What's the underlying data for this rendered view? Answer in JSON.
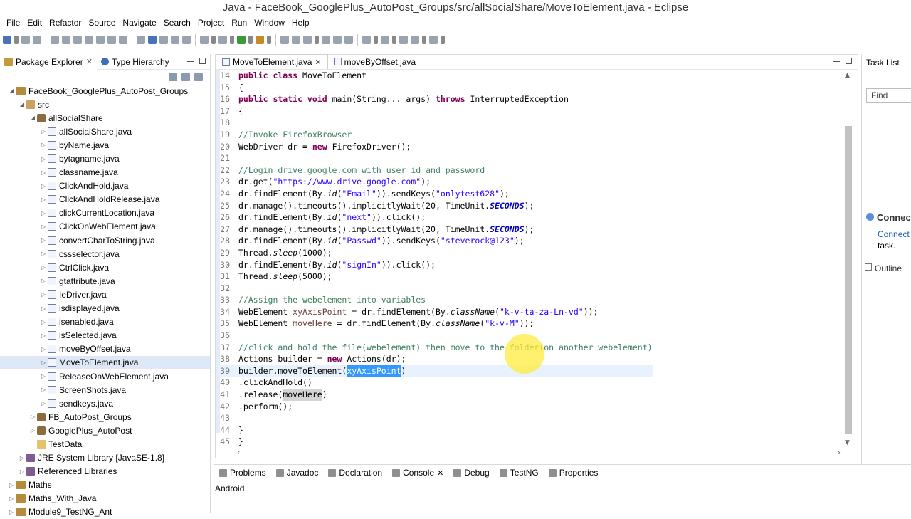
{
  "window": {
    "title": "Java - FaceBook_GooglePlus_AutoPost_Groups/src/allSocialShare/MoveToElement.java - Eclipse"
  },
  "menu": [
    "File",
    "Edit",
    "Refactor",
    "Source",
    "Navigate",
    "Search",
    "Project",
    "Run",
    "Window",
    "Help"
  ],
  "left_panel": {
    "tabs": [
      {
        "label": "Package Explorer",
        "active": true
      },
      {
        "label": "Type Hierarchy",
        "active": false
      }
    ],
    "tree": [
      {
        "label": "FaceBook_GooglePlus_AutoPost_Groups",
        "depth": 0,
        "arrow": "open",
        "icon": "proj"
      },
      {
        "label": "src",
        "depth": 1,
        "arrow": "open",
        "icon": "src"
      },
      {
        "label": "allSocialShare",
        "depth": 2,
        "arrow": "open",
        "icon": "pkg"
      },
      {
        "label": "allSocialShare.java",
        "depth": 3,
        "arrow": "closed",
        "icon": "java"
      },
      {
        "label": "byName.java",
        "depth": 3,
        "arrow": "closed",
        "icon": "java"
      },
      {
        "label": "bytagname.java",
        "depth": 3,
        "arrow": "closed",
        "icon": "java"
      },
      {
        "label": "classname.java",
        "depth": 3,
        "arrow": "closed",
        "icon": "java"
      },
      {
        "label": "ClickAndHold.java",
        "depth": 3,
        "arrow": "closed",
        "icon": "java"
      },
      {
        "label": "ClickAndHoldRelease.java",
        "depth": 3,
        "arrow": "closed",
        "icon": "java"
      },
      {
        "label": "clickCurrentLocation.java",
        "depth": 3,
        "arrow": "closed",
        "icon": "java"
      },
      {
        "label": "ClickOnWebElement.java",
        "depth": 3,
        "arrow": "closed",
        "icon": "java"
      },
      {
        "label": "convertCharToString.java",
        "depth": 3,
        "arrow": "closed",
        "icon": "java"
      },
      {
        "label": "cssselector.java",
        "depth": 3,
        "arrow": "closed",
        "icon": "java"
      },
      {
        "label": "CtrlClick.java",
        "depth": 3,
        "arrow": "closed",
        "icon": "java"
      },
      {
        "label": "gtattribute.java",
        "depth": 3,
        "arrow": "closed",
        "icon": "java"
      },
      {
        "label": "IeDriver.java",
        "depth": 3,
        "arrow": "closed",
        "icon": "java"
      },
      {
        "label": "isdisplayed.java",
        "depth": 3,
        "arrow": "closed",
        "icon": "java"
      },
      {
        "label": "isenabled.java",
        "depth": 3,
        "arrow": "closed",
        "icon": "java"
      },
      {
        "label": "isSelected.java",
        "depth": 3,
        "arrow": "closed",
        "icon": "java"
      },
      {
        "label": "moveByOffset.java",
        "depth": 3,
        "arrow": "closed",
        "icon": "java"
      },
      {
        "label": "MoveToElement.java",
        "depth": 3,
        "arrow": "closed",
        "icon": "java",
        "selected": true
      },
      {
        "label": "ReleaseOnWebElement.java",
        "depth": 3,
        "arrow": "closed",
        "icon": "java"
      },
      {
        "label": "ScreenShots.java",
        "depth": 3,
        "arrow": "closed",
        "icon": "java"
      },
      {
        "label": "sendkeys.java",
        "depth": 3,
        "arrow": "closed",
        "icon": "java"
      },
      {
        "label": "FB_AutoPost_Groups",
        "depth": 2,
        "arrow": "closed",
        "icon": "pkg"
      },
      {
        "label": "GooglePlus_AutoPost",
        "depth": 2,
        "arrow": "closed",
        "icon": "pkg"
      },
      {
        "label": "TestData",
        "depth": 2,
        "arrow": "none",
        "icon": "folder"
      },
      {
        "label": "JRE System Library [JavaSE-1.8]",
        "depth": 1,
        "arrow": "closed",
        "icon": "lib"
      },
      {
        "label": "Referenced Libraries",
        "depth": 1,
        "arrow": "closed",
        "icon": "lib"
      },
      {
        "label": "Maths",
        "depth": 0,
        "arrow": "closed",
        "icon": "proj"
      },
      {
        "label": "Maths_With_Java",
        "depth": 0,
        "arrow": "closed",
        "icon": "proj"
      },
      {
        "label": "Module9_TestNG_Ant",
        "depth": 0,
        "arrow": "closed",
        "icon": "proj"
      }
    ]
  },
  "editor": {
    "tabs": [
      {
        "label": "MoveToElement.java",
        "active": true
      },
      {
        "label": "moveByOffset.java",
        "active": false
      }
    ],
    "current_line": "39",
    "lines": [
      {
        "n": "14",
        "s": [
          [
            "kw",
            "public class "
          ],
          [
            "",
            "MoveToElement"
          ]
        ]
      },
      {
        "n": "15",
        "s": [
          [
            "",
            "{"
          ]
        ]
      },
      {
        "n": "16",
        "s": [
          [
            "kw",
            "public static void "
          ],
          [
            "",
            "main(String... args) "
          ],
          [
            "kw",
            "throws "
          ],
          [
            "",
            "InterruptedException"
          ]
        ]
      },
      {
        "n": "17",
        "s": [
          [
            "",
            "{"
          ]
        ]
      },
      {
        "n": "18",
        "s": []
      },
      {
        "n": "19",
        "s": [
          [
            "cm",
            "//Invoke FirefoxBrowser"
          ]
        ]
      },
      {
        "n": "20",
        "s": [
          [
            "",
            "WebDriver dr = "
          ],
          [
            "kw",
            "new "
          ],
          [
            "",
            "FirefoxDriver();"
          ]
        ]
      },
      {
        "n": "21",
        "s": []
      },
      {
        "n": "22",
        "s": [
          [
            "cm",
            "//Login drive.google.com with user id and password"
          ]
        ]
      },
      {
        "n": "23",
        "s": [
          [
            "",
            "dr.get("
          ],
          [
            "str",
            "\"https://www.drive.google.com\""
          ],
          [
            "",
            ");"
          ]
        ]
      },
      {
        "n": "24",
        "s": [
          [
            "",
            "dr.findElement(By."
          ],
          [
            "it",
            "id"
          ],
          [
            "",
            "("
          ],
          [
            "str",
            "\"Email\""
          ],
          [
            "",
            ")).sendKeys("
          ],
          [
            "str",
            "\"onlytest628\""
          ],
          [
            "",
            ");"
          ]
        ]
      },
      {
        "n": "25",
        "s": [
          [
            "",
            "dr.manage().timeouts().implicitlyWait(20, TimeUnit."
          ],
          [
            "itb",
            "SECONDS"
          ],
          [
            "",
            ");"
          ]
        ]
      },
      {
        "n": "26",
        "s": [
          [
            "",
            "dr.findElement(By."
          ],
          [
            "it",
            "id"
          ],
          [
            "",
            "("
          ],
          [
            "str",
            "\"next\""
          ],
          [
            "",
            ")).click();"
          ]
        ]
      },
      {
        "n": "27",
        "s": [
          [
            "",
            "dr.manage().timeouts().implicitlyWait(20, TimeUnit."
          ],
          [
            "itb",
            "SECONDS"
          ],
          [
            "",
            ");"
          ]
        ]
      },
      {
        "n": "28",
        "s": [
          [
            "",
            "dr.findElement(By."
          ],
          [
            "it",
            "id"
          ],
          [
            "",
            "("
          ],
          [
            "str",
            "\"Passwd\""
          ],
          [
            "",
            ")).sendKeys("
          ],
          [
            "str",
            "\"steverock@123\""
          ],
          [
            "",
            ");"
          ]
        ]
      },
      {
        "n": "29",
        "s": [
          [
            "",
            "Thread."
          ],
          [
            "it",
            "sleep"
          ],
          [
            "",
            "(1000);"
          ]
        ]
      },
      {
        "n": "30",
        "s": [
          [
            "",
            "dr.findElement(By."
          ],
          [
            "it",
            "id"
          ],
          [
            "",
            "("
          ],
          [
            "str",
            "\"signIn\""
          ],
          [
            "",
            ")).click();"
          ]
        ]
      },
      {
        "n": "31",
        "s": [
          [
            "",
            "Thread."
          ],
          [
            "it",
            "sleep"
          ],
          [
            "",
            "(5000);"
          ]
        ]
      },
      {
        "n": "32",
        "s": []
      },
      {
        "n": "33",
        "s": [
          [
            "cm",
            "//Assign the webelement into variables"
          ]
        ]
      },
      {
        "n": "34",
        "s": [
          [
            "",
            "WebElement "
          ],
          [
            "var",
            "xyAxisPoint"
          ],
          [
            "",
            " = dr.findElement(By."
          ],
          [
            "it",
            "className"
          ],
          [
            "",
            "("
          ],
          [
            "str",
            "\"k-v-ta-za-Ln-vd\""
          ],
          [
            "",
            "));"
          ]
        ]
      },
      {
        "n": "35",
        "s": [
          [
            "",
            "WebElement "
          ],
          [
            "var",
            "moveHere"
          ],
          [
            "",
            " = dr.findElement(By."
          ],
          [
            "it",
            "className"
          ],
          [
            "",
            "("
          ],
          [
            "str",
            "\"k-v-M\""
          ],
          [
            "",
            "));"
          ]
        ]
      },
      {
        "n": "36",
        "s": []
      },
      {
        "n": "37",
        "s": [
          [
            "cm",
            "//click and hold the file(webelement) then move to the folder(on another webelement)"
          ]
        ]
      },
      {
        "n": "38",
        "s": [
          [
            "",
            "Actions builder = "
          ],
          [
            "kw",
            "new "
          ],
          [
            "",
            "Actions(dr);"
          ]
        ]
      },
      {
        "n": "39",
        "s": [
          [
            "",
            "builder.moveToElement("
          ],
          [
            "hl",
            "xyAxisPoint"
          ],
          [
            "",
            ")"
          ]
        ]
      },
      {
        "n": "40",
        "s": [
          [
            "",
            ".clickAndHold()"
          ]
        ]
      },
      {
        "n": "41",
        "s": [
          [
            "",
            ".release("
          ],
          [
            "hl2",
            "moveHere"
          ],
          [
            "",
            ")"
          ]
        ]
      },
      {
        "n": "42",
        "s": [
          [
            "",
            ".perform();"
          ]
        ]
      },
      {
        "n": "43",
        "s": []
      },
      {
        "n": "44",
        "s": [
          [
            "",
            "}"
          ]
        ]
      },
      {
        "n": "45",
        "s": [
          [
            "",
            "}"
          ]
        ]
      }
    ]
  },
  "right_panel": {
    "task_list_label": "Task List",
    "find_placeholder": "Find",
    "connect_title": "Connec",
    "connect_link": "Connect",
    "connect_task": "task.",
    "outline_label": "Outline"
  },
  "bottom_panel": {
    "tabs": [
      {
        "label": "Problems",
        "active": false
      },
      {
        "label": "Javadoc",
        "active": false
      },
      {
        "label": "Declaration",
        "active": false
      },
      {
        "label": "Console",
        "active": true
      },
      {
        "label": "Debug",
        "active": false
      },
      {
        "label": "TestNG",
        "active": false
      },
      {
        "label": "Properties",
        "active": false
      }
    ],
    "console_content": "Android"
  }
}
